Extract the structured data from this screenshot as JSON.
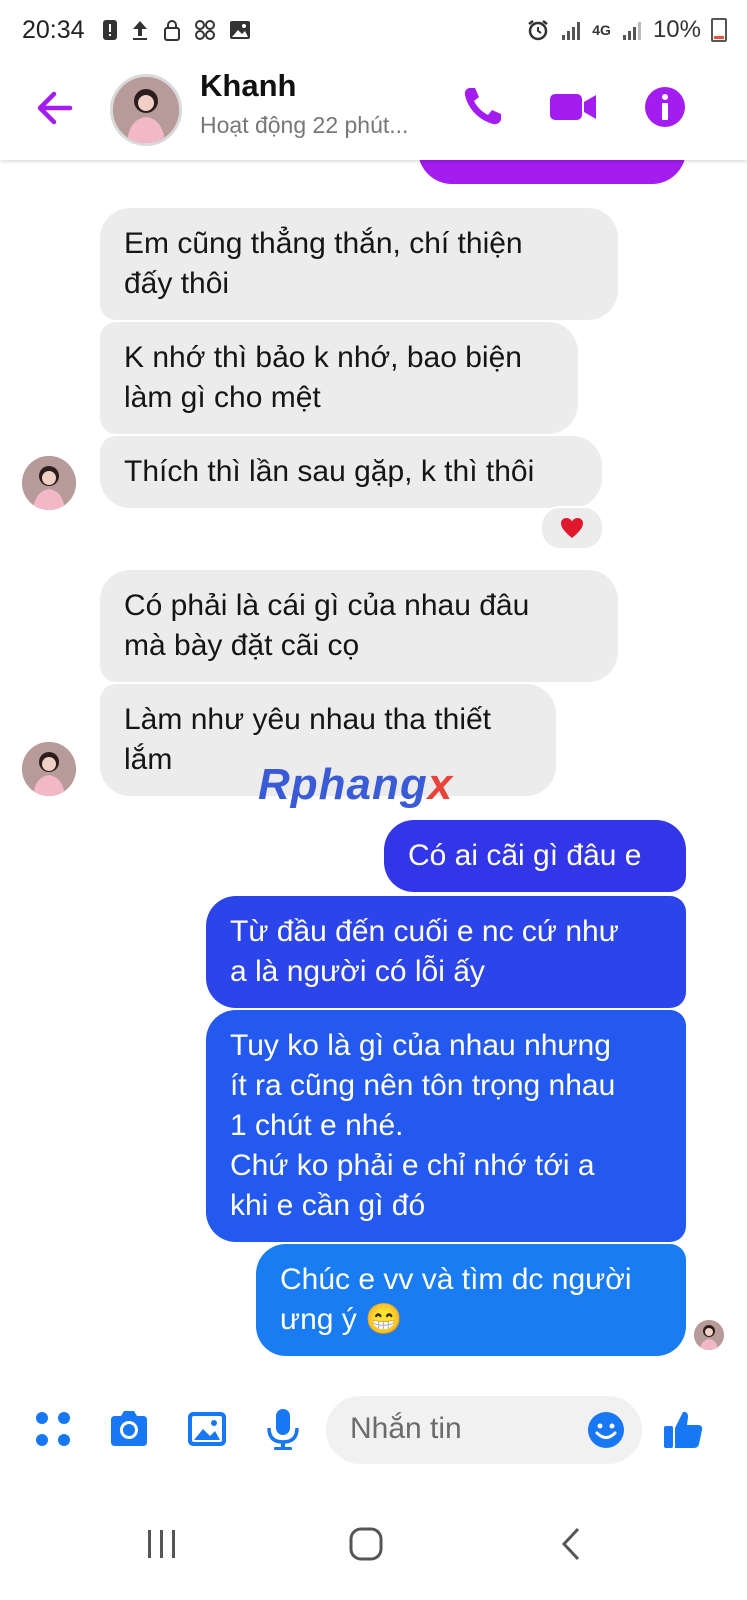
{
  "status_bar": {
    "time": "20:34",
    "network": "4G",
    "battery": "10%"
  },
  "header": {
    "name": "Khanh",
    "status": "Hoạt động 22 phút..."
  },
  "messages": {
    "m1": "Em cũng thẳng thắn, chí thiện\nđấy thôi",
    "m2": "K nhớ thì bảo k nhớ, bao biện\nlàm gì cho mệt",
    "m3": "Thích thì lần sau gặp, k thì thôi",
    "m4": "Có phải là cái gì của nhau đâu\nmà bày đặt cãi cọ",
    "m5": "Làm như yêu nhau tha thiết\nlắm",
    "m6": "Có ai cãi gì đâu e",
    "m7": "Từ đầu đến cuối e nc cứ như\na là người có lỗi ấy",
    "m8": "Tuy ko là gì của nhau nhưng\nít ra cũng nên tôn trọng nhau\n1 chút e nhé.\nChứ ko phải e chỉ nhớ tới a\nkhi e cần gì đó",
    "m9": "Chúc e vv và tìm dc người\nưng ý 😁"
  },
  "reaction": "❤️",
  "watermark": {
    "part1": "Rphang",
    "part2": "x"
  },
  "composer": {
    "placeholder": "Nhắn tin"
  },
  "colors": {
    "accent": "#a31cf0",
    "outgoing": "#2f3ee6",
    "incoming": "#ececec"
  }
}
